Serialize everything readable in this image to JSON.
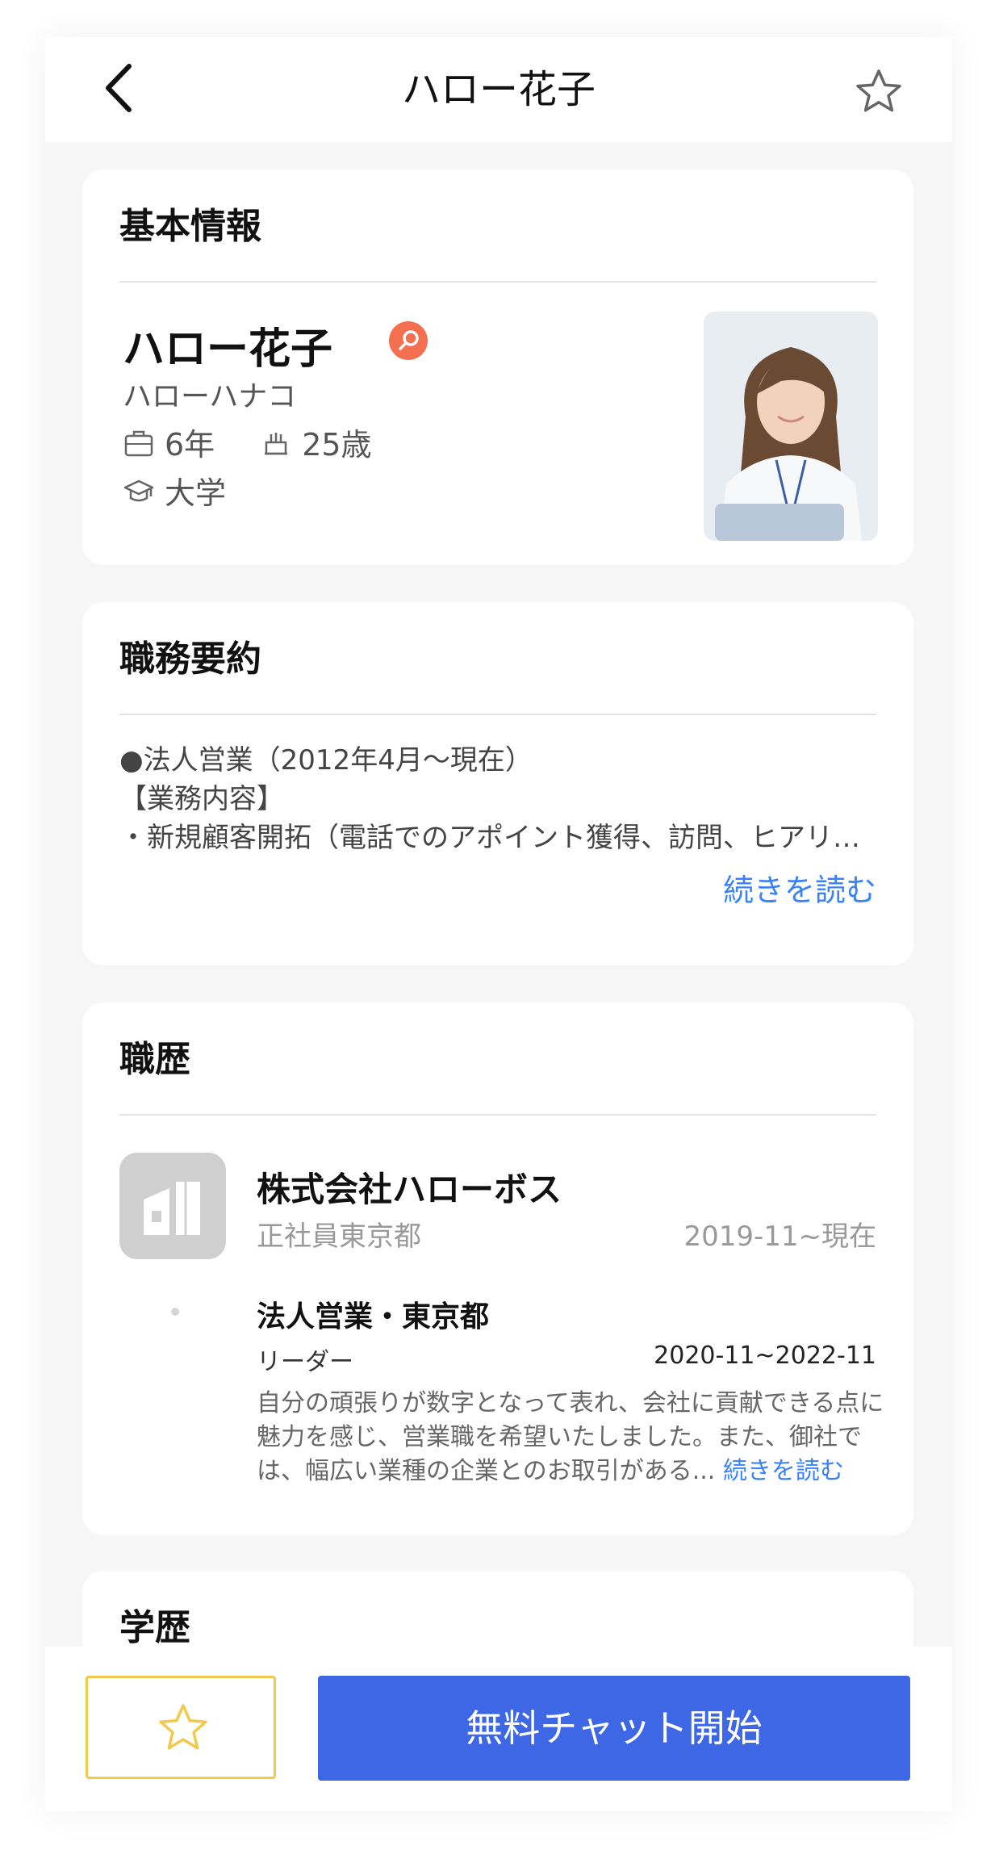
{
  "header": {
    "title": "ハロー花子"
  },
  "basic_info": {
    "section_title": "基本情報",
    "name": "ハロー花子",
    "kana": "ハローハナコ",
    "experience": "6年",
    "age": "25歳",
    "education": "大学"
  },
  "summary": {
    "section_title": "職務要約",
    "lines": [
      "●法人営業（2012年4月〜現在）",
      "【業務内容】",
      "・新規顧客開拓（電話でのアポイント獲得、訪問、ヒアリ…"
    ],
    "read_more": "続きを読む"
  },
  "career": {
    "section_title": "職歴",
    "company": "株式会社ハローボス",
    "company_sub": "正社員東京都",
    "company_period": "2019-11~現在",
    "job_title": "法人営業・東京都",
    "job_role": "リーダー",
    "job_period": "2020-11~2022-11",
    "job_desc": "自分の頑張りが数字となって表れ、会社に貢献できる点に魅力を感じ、営業職を希望いたしました。また、御社では、幅広い業種の企業とのお取引がある...",
    "read_more": "続きを読む"
  },
  "next_section": {
    "title": "学歴"
  },
  "bottom": {
    "chat_button": "無料チャット開始"
  },
  "colors": {
    "accent": "#3d67e4",
    "link": "#3b82f6",
    "badge": "#f36f4f",
    "fav_border": "#f2c94c"
  },
  "icons": [
    "back-icon",
    "star-icon",
    "briefcase-icon",
    "cake-icon",
    "graduation-icon",
    "search-badge-icon",
    "building-icon"
  ]
}
